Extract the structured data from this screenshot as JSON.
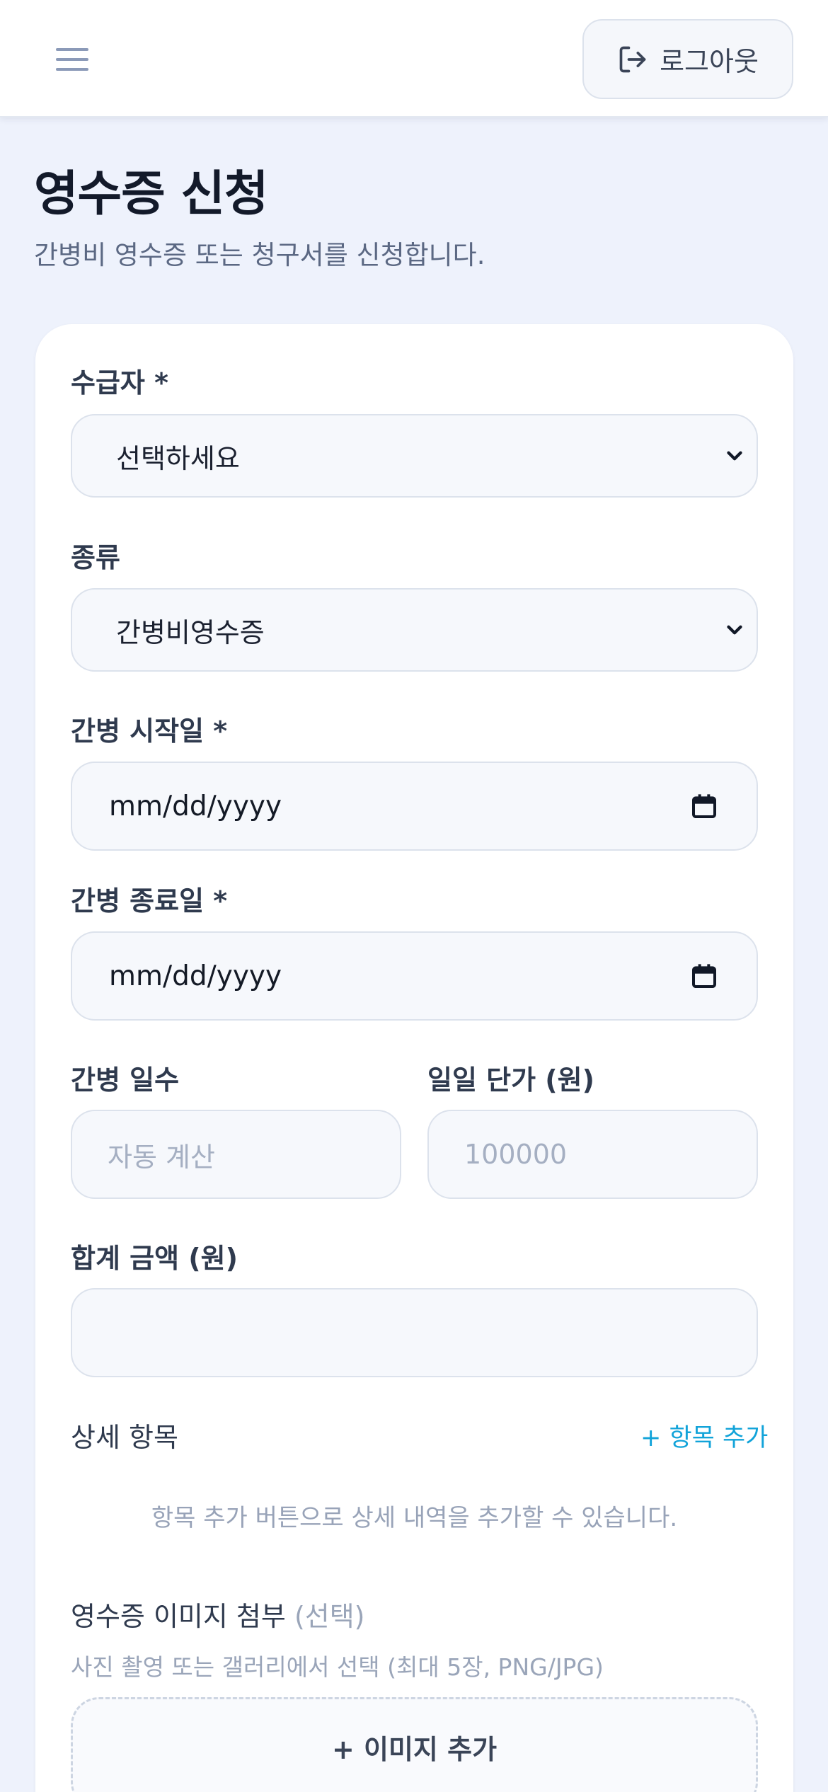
{
  "header": {
    "logout_label": "로그아웃"
  },
  "page": {
    "title": "영수증 신청",
    "subtitle": "간병비 영수증 또는 청구서를 신청합니다."
  },
  "form": {
    "recipient": {
      "label": "수급자 *",
      "value": "선택하세요"
    },
    "type": {
      "label": "종류",
      "value": "간병비영수증"
    },
    "start_date": {
      "label": "간병 시작일 *",
      "value": "mm/dd/yyyy"
    },
    "end_date": {
      "label": "간병 종료일 *",
      "value": "mm/dd/yyyy"
    },
    "days": {
      "label": "간병 일수",
      "placeholder": "자동 계산"
    },
    "daily_rate": {
      "label": "일일 단가 (원)",
      "placeholder": "100000"
    },
    "total": {
      "label": "합계 금액 (원)",
      "value": ""
    },
    "details": {
      "label": "상세 항목",
      "add_link": "+ 항목 추가",
      "empty_message": "항목 추가 버튼으로 상세 내역을 추가할 수 있습니다."
    },
    "attachments": {
      "label": "영수증 이미지 첨부",
      "label_suffix": "(선택)",
      "helper": "사진 촬영 또는 갤러리에서 선택 (최대 5장, PNG/JPG)",
      "add_button": "+ 이미지 추가"
    }
  },
  "icons": [
    "menu-icon",
    "logout-icon",
    "chevron-down-icon",
    "calendar-icon"
  ],
  "colors": {
    "background": "#EEF2FC",
    "accent_link": "#11A3D9",
    "card": "#FFFFFF"
  }
}
